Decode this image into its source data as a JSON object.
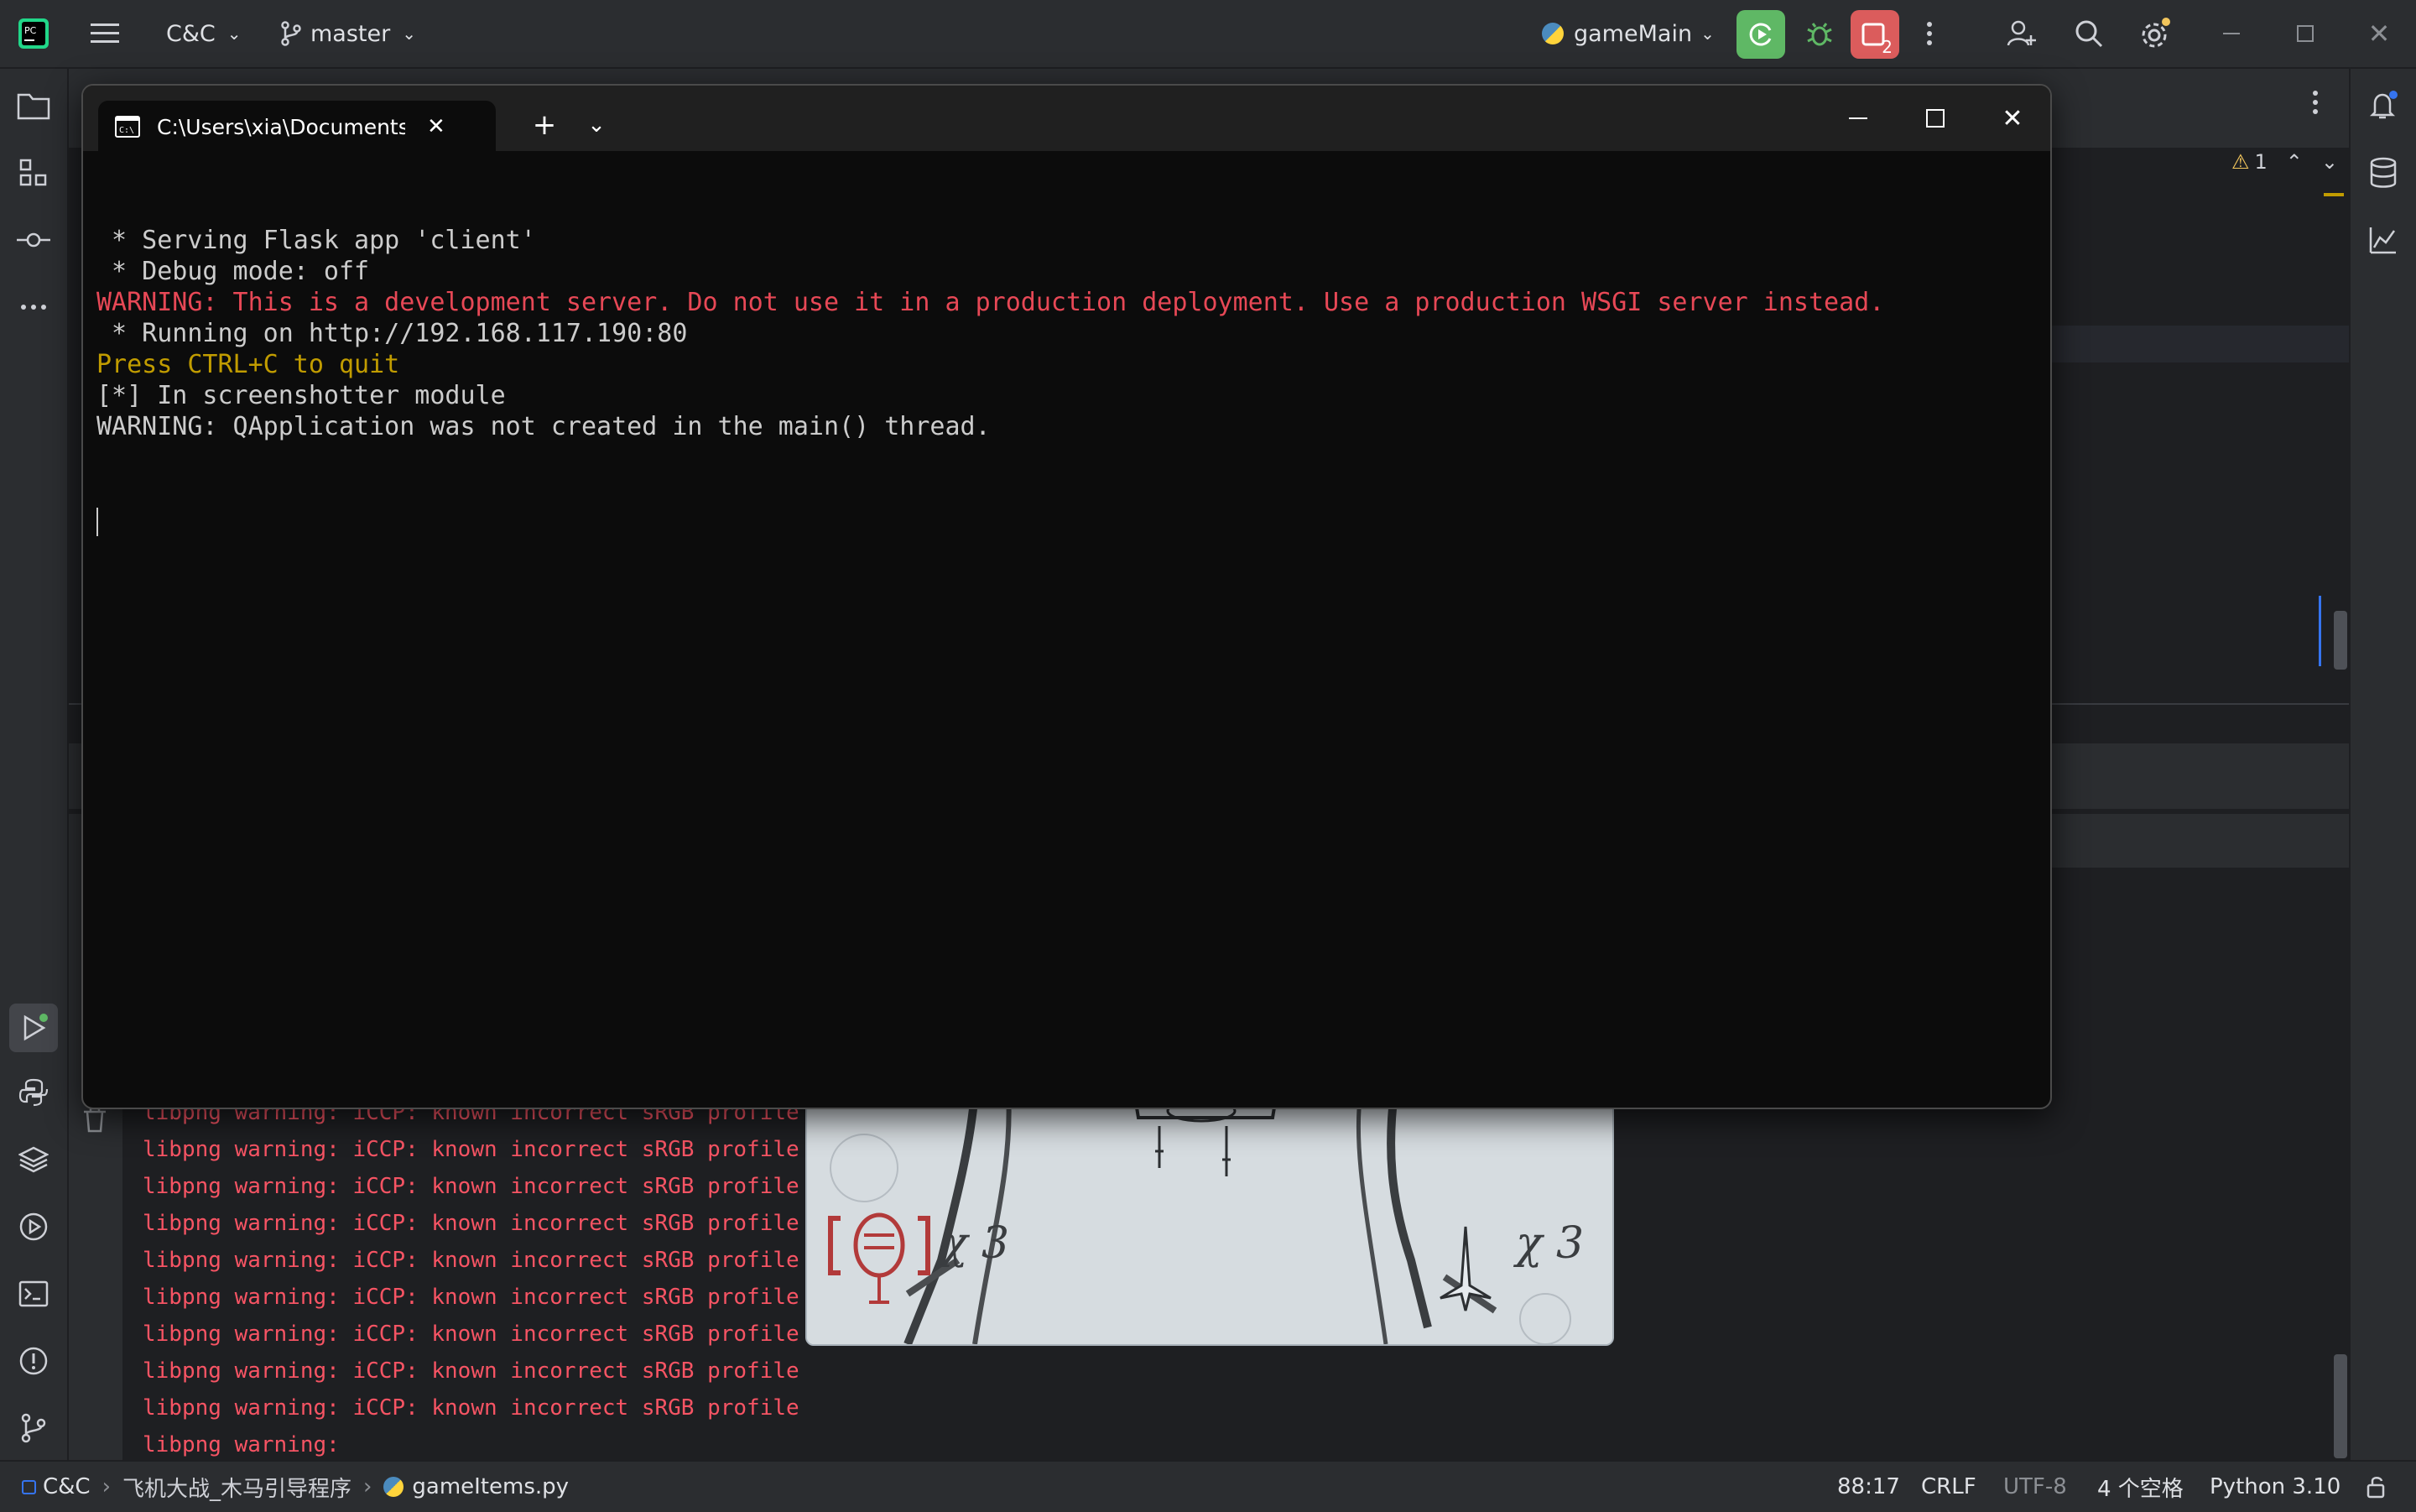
{
  "colors": {
    "ide_bg": "#1e1f22",
    "panel_bg": "#2b2d30",
    "run_green": "#5fb865",
    "stop_red": "#db5c5c",
    "warn_red": "#e74856",
    "warn_yellow": "#c19c00",
    "badge_yellow": "#f2c55c",
    "term_bg": "#0c0c0c"
  },
  "topbar": {
    "project": "C&C",
    "branch": "master",
    "run_config": "gameMain",
    "stop_badge": "2",
    "icons": [
      "app-logo-icon",
      "hamburger-menu-icon",
      "git-branch-icon",
      "run-icon",
      "debug-icon",
      "stop-icon",
      "more-vertical-icon",
      "add-user-icon",
      "search-icon",
      "settings-icon"
    ]
  },
  "left_stripe": {
    "icons": [
      "project-folder-icon",
      "structure-icon",
      "commit-icon",
      "more-horizontal-icon",
      "run-tool-icon",
      "python-console-icon",
      "layers-icon",
      "services-icon",
      "terminal-icon",
      "problems-icon",
      "git-icon"
    ]
  },
  "right_stripe": {
    "icons": [
      "notifications-icon",
      "database-icon",
      "sciview-icon"
    ]
  },
  "editor": {
    "warning_count": "1"
  },
  "terminal": {
    "tab_title": "C:\\Users\\xia\\Documents\\gam",
    "lines": [
      {
        "text": " * Serving Flask app 'client'",
        "color": "#cccccc"
      },
      {
        "text": " * Debug mode: off",
        "color": "#cccccc"
      },
      {
        "text": "WARNING: This is a development server. Do not use it in a production deployment. Use a production WSGI server instead.",
        "color": "#e74856"
      },
      {
        "text": " * Running on http://192.168.117.190:80",
        "color": "#cccccc"
      },
      {
        "text": "Press CTRL+C to quit",
        "color": "#c19c00"
      },
      {
        "text": "[*] In screenshotter module",
        "color": "#cccccc"
      },
      {
        "text": "WARNING: QApplication was not created in the main() thread.",
        "color": "#cccccc"
      }
    ]
  },
  "run_console": {
    "lines": [
      "libpng warning: iCCP: known incorrect sRGB profile",
      "libpng warning: iCCP: known incorrect sRGB profile",
      "libpng warning: iCCP: known incorrect sRGB profile",
      "libpng warning: iCCP: known incorrect sRGB profile",
      "libpng warning: iCCP: known incorrect sRGB profile",
      "libpng warning: iCCP: known incorrect sRGB profile",
      "libpng warning: iCCP: known incorrect sRGB profile",
      "libpng warning: iCCP: known incorrect sRGB profile",
      "libpng warning: iCCP: known incorrect sRGB profile",
      "libpng warning:"
    ]
  },
  "game": {
    "bomb_count": "χ 3",
    "lives_count": "χ 3"
  },
  "statusbar": {
    "project": "C&C",
    "folder": "飞机大战_木马引导程序",
    "file": "gameItems.py",
    "position": "88:17",
    "line_sep": "CRLF",
    "encoding": "UTF-8",
    "indent": "4 个空格",
    "interpreter": "Python 3.10"
  }
}
